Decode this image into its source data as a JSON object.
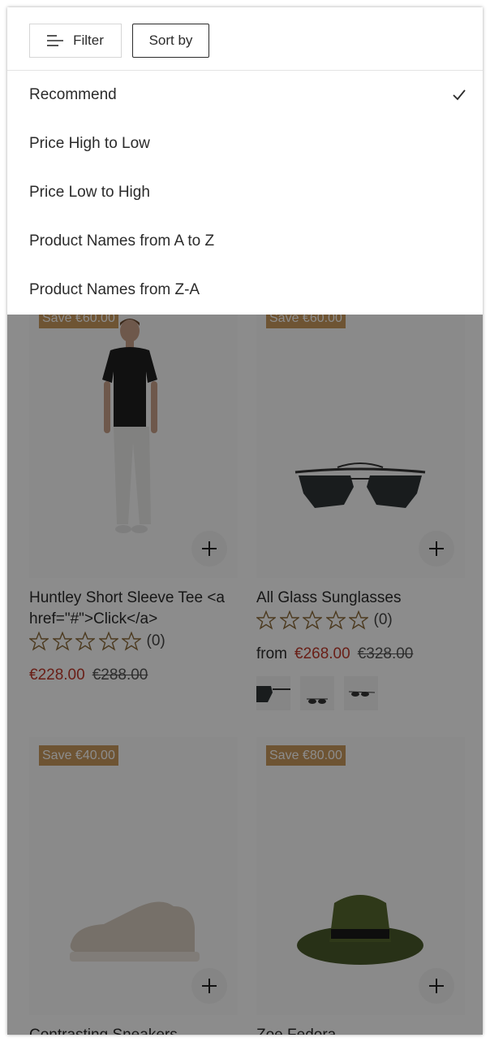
{
  "toolbar": {
    "filter_label": "Filter",
    "sort_label": "Sort by"
  },
  "sort_menu": {
    "options": [
      {
        "label": "Recommend",
        "selected": true
      },
      {
        "label": "Price High to Low",
        "selected": false
      },
      {
        "label": "Price Low to High",
        "selected": false
      },
      {
        "label": "Product Names from A to Z",
        "selected": false
      },
      {
        "label": "Product Names from Z-A",
        "selected": false
      }
    ]
  },
  "products": [
    {
      "badge": "Save €60.00",
      "title": "Huntley Short Sleeve Tee <a href=\"#\">Click</a>",
      "rating_count": "(0)",
      "price_prefix": "",
      "sale_price": "€228.00",
      "original_price": "€288.00",
      "image": "tshirt-model-image"
    },
    {
      "badge": "Save €60.00",
      "title": "All Glass Sunglasses",
      "rating_count": "(0)",
      "price_prefix": "from",
      "sale_price": "€268.00",
      "original_price": "€328.00",
      "image": "sunglasses-image",
      "swatches": [
        "sunglasses-swatch-1",
        "sunglasses-swatch-2",
        "sunglasses-swatch-3"
      ]
    },
    {
      "badge": "Save €40.00",
      "title": "Contrasting Sneakers",
      "image": "sneaker-image"
    },
    {
      "badge": "Save €80.00",
      "title": "Zoe Fedora",
      "image": "fedora-image"
    }
  ],
  "colors": {
    "sale_red": "#c0392b",
    "badge_tan": "#c99a5e",
    "star_outline": "#8a6a3a",
    "overlay": "rgba(0,0,0,0.45)"
  }
}
